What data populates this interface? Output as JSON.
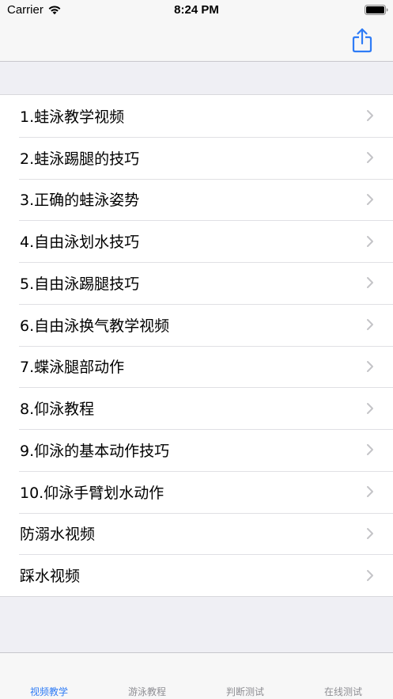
{
  "status_bar": {
    "carrier": "Carrier",
    "time": "8:24 PM",
    "wifi_icon": "wifi-icon",
    "battery_icon": "battery-full-icon"
  },
  "nav_bar": {
    "share_icon": "share-icon",
    "accent_color": "#2f7cf6"
  },
  "list": {
    "items": [
      {
        "label": "1.蛙泳教学视频"
      },
      {
        "label": "2.蛙泳踢腿的技巧"
      },
      {
        "label": "3.正确的蛙泳姿势"
      },
      {
        "label": "4.自由泳划水技巧"
      },
      {
        "label": "5.自由泳踢腿技巧"
      },
      {
        "label": "6.自由泳换气教学视频"
      },
      {
        "label": "7.蝶泳腿部动作"
      },
      {
        "label": "8.仰泳教程"
      },
      {
        "label": "9.仰泳的基本动作技巧"
      },
      {
        "label": "10.仰泳手臂划水动作"
      },
      {
        "label": "防溺水视频"
      },
      {
        "label": "踩水视频"
      }
    ],
    "chevron_icon": "chevron-right-icon"
  },
  "tab_bar": {
    "tabs": [
      {
        "label": "视频教学",
        "active": true
      },
      {
        "label": "游泳教程",
        "active": false
      },
      {
        "label": "判断测试",
        "active": false
      },
      {
        "label": "在线测试",
        "active": false
      }
    ]
  }
}
